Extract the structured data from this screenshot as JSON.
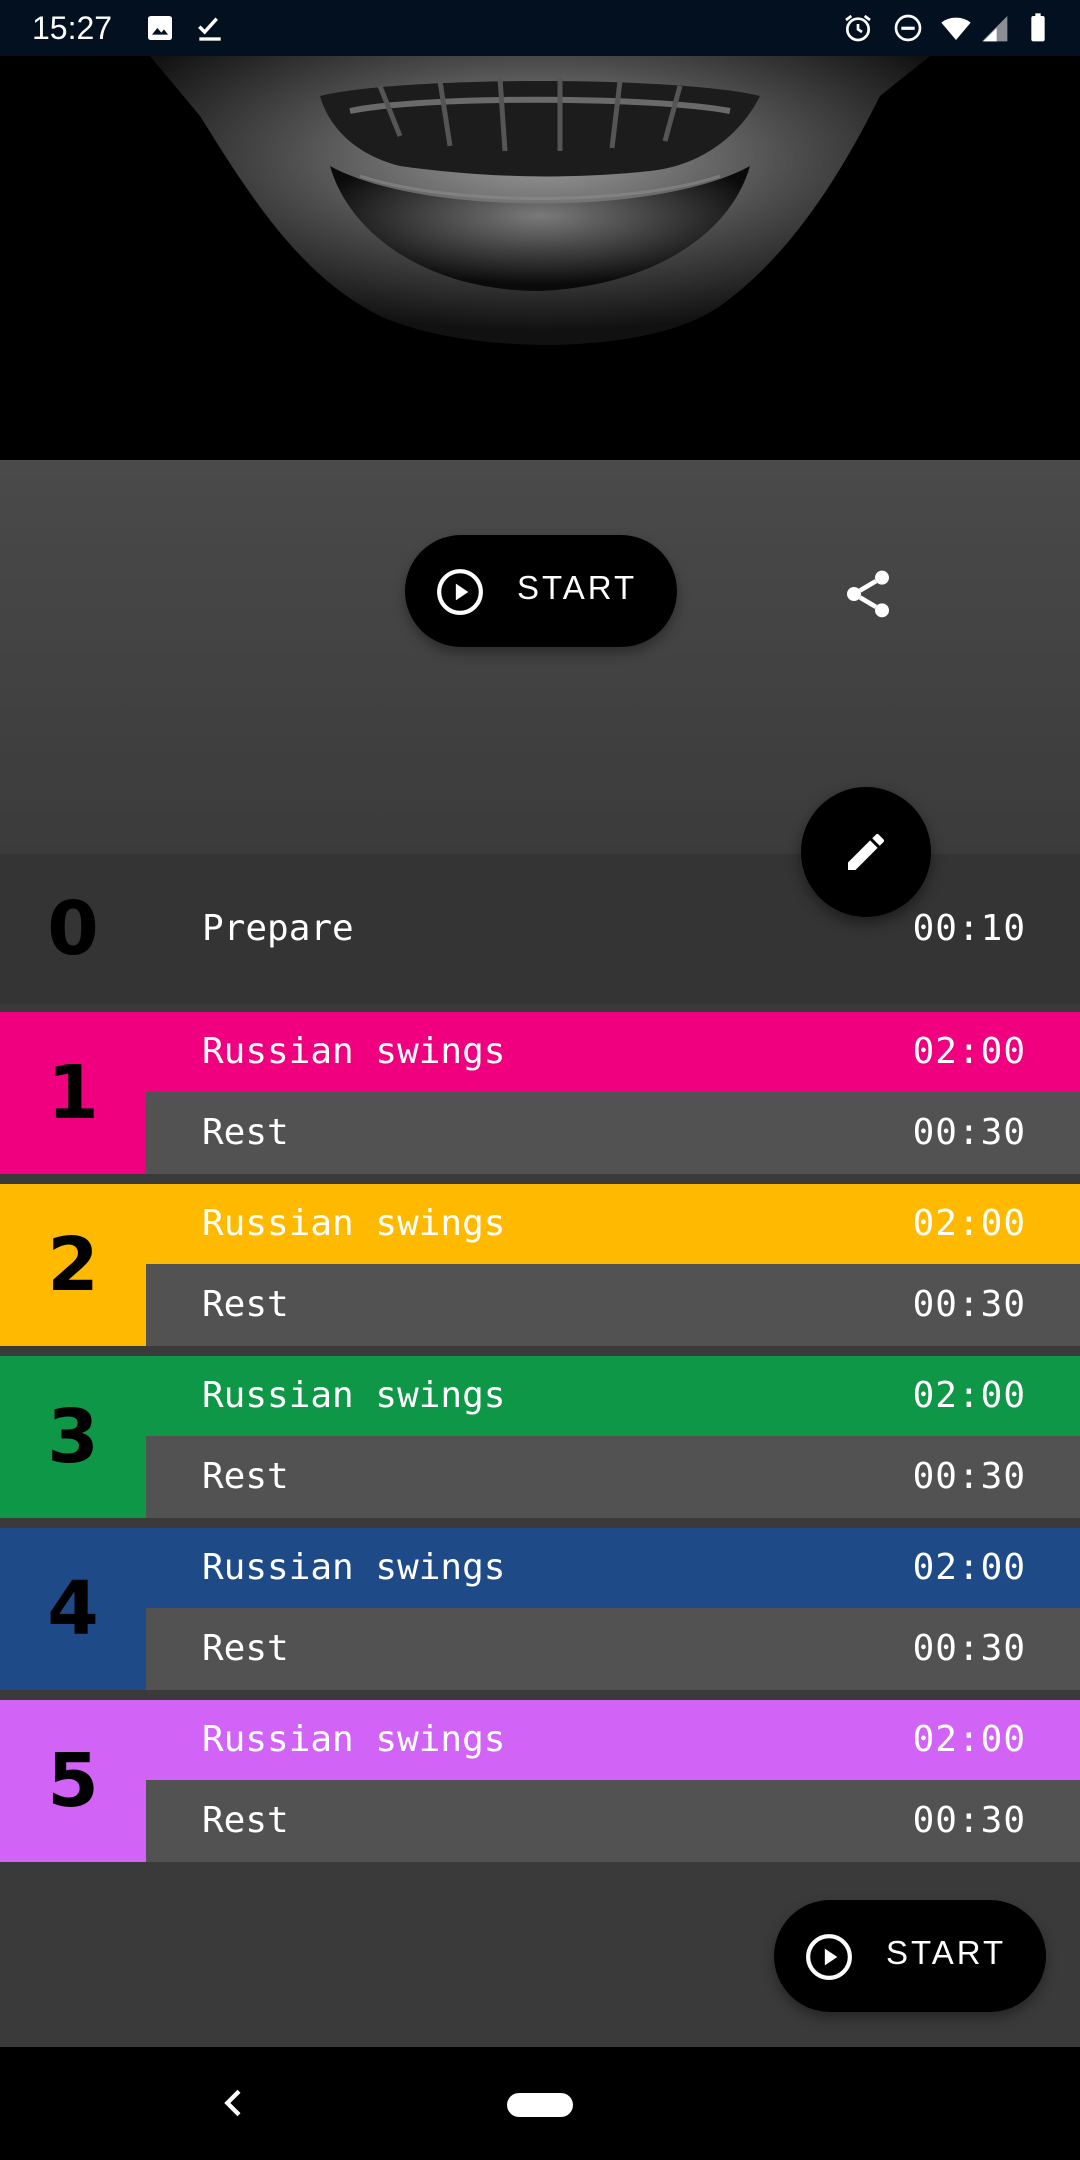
{
  "status_bar": {
    "time": "15:27",
    "icons_left": [
      "image-icon",
      "check-icon"
    ],
    "icons_right": [
      "alarm-icon",
      "do-not-disturb-icon",
      "wifi-icon",
      "signal-icon",
      "battery-icon"
    ]
  },
  "header": {
    "start_label": "START",
    "share_icon": "share-icon",
    "edit_icon": "pencil-icon"
  },
  "prepare": {
    "index": "0",
    "name": "Prepare",
    "duration": "00:10",
    "color": "#343434"
  },
  "sets": [
    {
      "index": "1",
      "color": "#f0007f",
      "work": {
        "name": "Russian swings",
        "duration": "02:00"
      },
      "rest": {
        "name": "Rest",
        "duration": "00:30"
      }
    },
    {
      "index": "2",
      "color": "#ffba00",
      "work": {
        "name": "Russian swings",
        "duration": "02:00"
      },
      "rest": {
        "name": "Rest",
        "duration": "00:30"
      }
    },
    {
      "index": "3",
      "color": "#0f9748",
      "work": {
        "name": "Russian swings",
        "duration": "02:00"
      },
      "rest": {
        "name": "Rest",
        "duration": "00:30"
      }
    },
    {
      "index": "4",
      "color": "#1e4a88",
      "work": {
        "name": "Russian swings",
        "duration": "02:00"
      },
      "rest": {
        "name": "Rest",
        "duration": "00:30"
      }
    },
    {
      "index": "5",
      "color": "#d263f7",
      "work": {
        "name": "Russian swings",
        "duration": "02:00"
      },
      "rest": {
        "name": "Rest",
        "duration": "00:30"
      }
    }
  ],
  "footer": {
    "start_label": "START"
  },
  "nav": {
    "back_icon": "back-chevron-icon",
    "home_icon": "home-pill-icon"
  },
  "colors": {
    "rest_row": "#525252",
    "status_bar": "#02101f",
    "pill": "#000000"
  }
}
